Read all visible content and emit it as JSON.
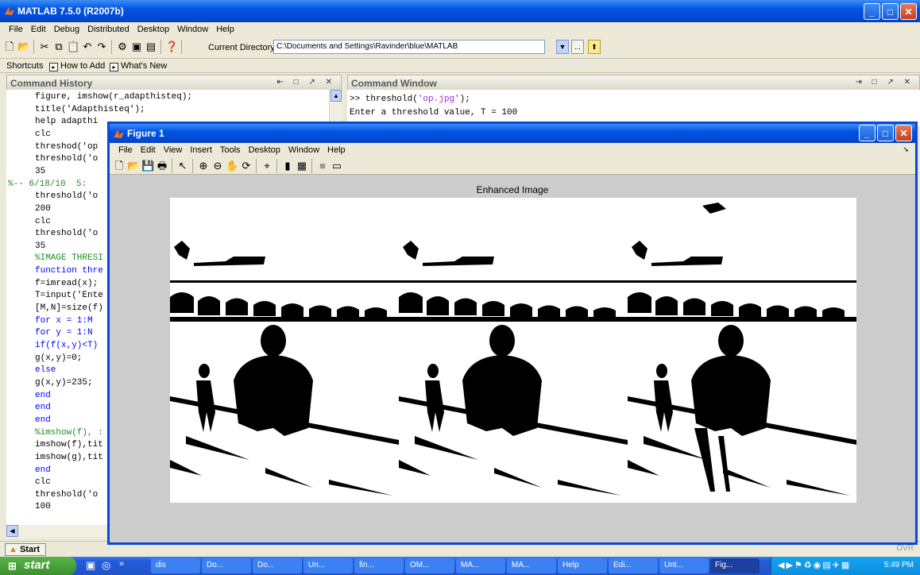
{
  "app": {
    "title": "MATLAB 7.5.0 (R2007b)",
    "menu": [
      "File",
      "Edit",
      "Debug",
      "Distributed",
      "Desktop",
      "Window",
      "Help"
    ],
    "window_buttons": [
      "_",
      "□",
      "✕"
    ]
  },
  "toolbar": {
    "current_directory_label": "Current Directory:",
    "current_directory_value": "C:\\Documents and Settings\\Ravinder\\blue\\MATLAB",
    "browse_label": "...",
    "up_label": "⬆"
  },
  "shortcuts": {
    "label": "Shortcuts",
    "how_to_add": "How to Add",
    "whats_new": "What's New"
  },
  "command_history": {
    "title": "Command History",
    "controls": "⇤ □ ↗ ✕",
    "lines": [
      {
        "text": "figure, imshow(r_adapthisteq);",
        "cls": ""
      },
      {
        "text": "title('Adapthisteq');",
        "cls": ""
      },
      {
        "text": "help adapthi",
        "cls": ""
      },
      {
        "text": "clc",
        "cls": ""
      },
      {
        "text": "threshod('op",
        "cls": ""
      },
      {
        "text": "threshold('o",
        "cls": ""
      },
      {
        "text": "35",
        "cls": ""
      },
      {
        "text": "%-- 6/18/10  5:",
        "cls": "cm"
      },
      {
        "text": "threshold('o",
        "cls": ""
      },
      {
        "text": "200",
        "cls": ""
      },
      {
        "text": "clc",
        "cls": ""
      },
      {
        "text": "threshold('o",
        "cls": ""
      },
      {
        "text": "35",
        "cls": ""
      },
      {
        "text": "%IMAGE THRESI",
        "cls": "cm"
      },
      {
        "text": "function thre",
        "cls": "kw"
      },
      {
        "text": "f=imread(x);",
        "cls": ""
      },
      {
        "text": "T=input('Ente",
        "cls": ""
      },
      {
        "text": "[M,N]=size(f)",
        "cls": ""
      },
      {
        "text": "for x = 1:M",
        "cls": "kw"
      },
      {
        "text": "for y = 1:N",
        "cls": "kw"
      },
      {
        "text": "if(f(x,y)<T)",
        "cls": "kw"
      },
      {
        "text": "g(x,y)=0;",
        "cls": ""
      },
      {
        "text": "else",
        "cls": "kw"
      },
      {
        "text": "g(x,y)=235;",
        "cls": ""
      },
      {
        "text": "end",
        "cls": "kw"
      },
      {
        "text": "end",
        "cls": "kw"
      },
      {
        "text": "end",
        "cls": "kw"
      },
      {
        "text": "%imshow(f), :",
        "cls": "cm"
      },
      {
        "text": "imshow(f),tit",
        "cls": ""
      },
      {
        "text": "imshow(g),tit",
        "cls": ""
      },
      {
        "text": "end",
        "cls": "kw"
      },
      {
        "text": "clc",
        "cls": ""
      },
      {
        "text": "threshold('o",
        "cls": ""
      },
      {
        "text": "100",
        "cls": ""
      }
    ]
  },
  "command_window": {
    "title": "Command Window",
    "controls": "⇥ □ ↗ ✕",
    "line1_prompt": ">> threshold(",
    "line1_string": "'op.jpg'",
    "line1_end": ");",
    "line2": "Enter a threshold value, T = 100"
  },
  "start_button": "Start",
  "status_ovr": "OVR",
  "figure": {
    "title": "Figure 1",
    "menu": [
      "File",
      "Edit",
      "View",
      "Insert",
      "Tools",
      "Desktop",
      "Window",
      "Help"
    ],
    "axes_title": "Enhanced Image"
  },
  "taskbar": {
    "start_label": "start",
    "items": [
      "dis",
      "Do...",
      "Do...",
      "Un...",
      "fin...",
      "OM...",
      "MA...",
      "MA...",
      "Help",
      "Edi...",
      "Unt...",
      "Fig..."
    ],
    "clock": "5:49 PM"
  },
  "colors": {
    "xp_blue": "#0054e3",
    "taskbar": "#245edb",
    "start_green": "#3c8f2e"
  }
}
